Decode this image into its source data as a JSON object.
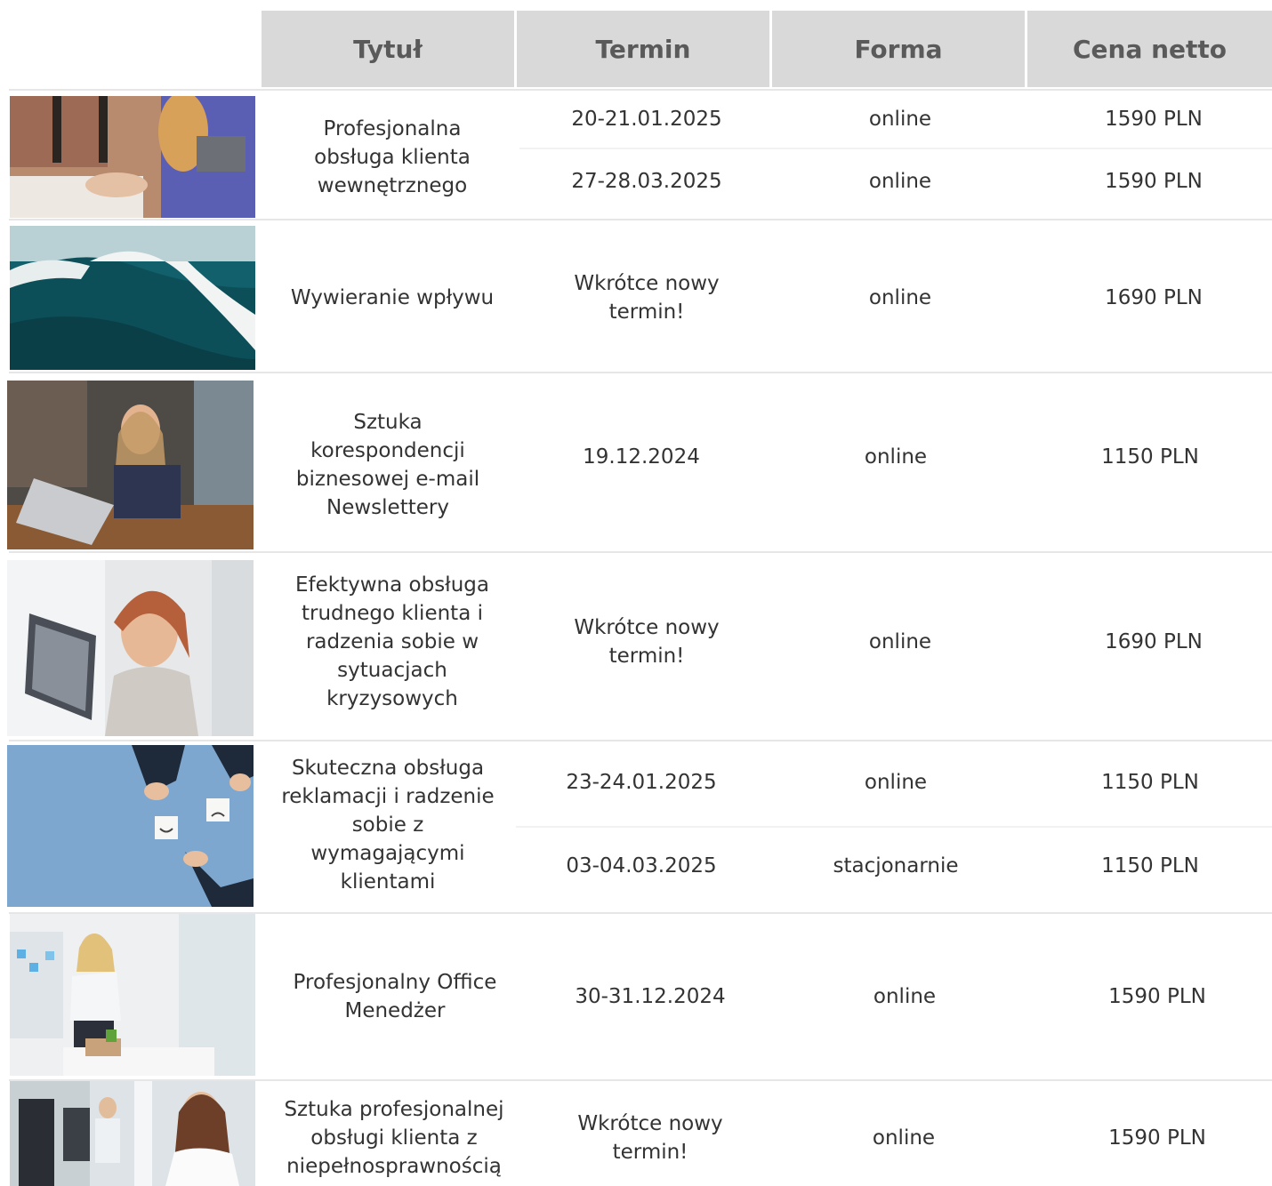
{
  "headers": {
    "title": "Tytuł",
    "date": "Termin",
    "form": "Forma",
    "price": "Cena netto"
  },
  "courses": [
    {
      "title": "Profesjonalna obsługa klienta wewnętrznego",
      "sessions": [
        {
          "date": "20-21.01.2025",
          "form": "online",
          "price": "1590 PLN"
        },
        {
          "date": "27-28.03.2025",
          "form": "online",
          "price": "1590 PLN"
        }
      ]
    },
    {
      "title": "Wywieranie wpływu",
      "sessions": [
        {
          "date": "Wkrótce nowy termin!",
          "form": "online",
          "price": "1690 PLN"
        }
      ]
    },
    {
      "title": "Sztuka korespondencji biznesowej e-mail Newslettery",
      "sessions": [
        {
          "date": "19.12.2024",
          "form": "online",
          "price": "1150 PLN"
        }
      ]
    },
    {
      "title": "Efektywna obsługa trudnego klienta i radzenia sobie w sytuacjach kryzysowych",
      "sessions": [
        {
          "date": "Wkrótce nowy termin!",
          "form": "online",
          "price": "1690 PLN"
        }
      ]
    },
    {
      "title": "Skuteczna obsługa reklamacji i radzenie sobie z wymagającymi klientami",
      "sessions": [
        {
          "date": "23-24.01.2025",
          "form": "online",
          "price": "1150 PLN"
        },
        {
          "date": "03-04.03.2025",
          "form": "stacjonarnie",
          "price": "1150 PLN"
        }
      ]
    },
    {
      "title": "Profesjonalny Office Menedżer",
      "sessions": [
        {
          "date": "30-31.12.2024",
          "form": "online",
          "price": "1590 PLN"
        }
      ]
    },
    {
      "title": "Sztuka profesjonalnej obsługi klienta z niepełnosprawnością",
      "sessions": [
        {
          "date": "Wkrótce nowy termin!",
          "form": "online",
          "price": "1590 PLN"
        }
      ]
    }
  ]
}
